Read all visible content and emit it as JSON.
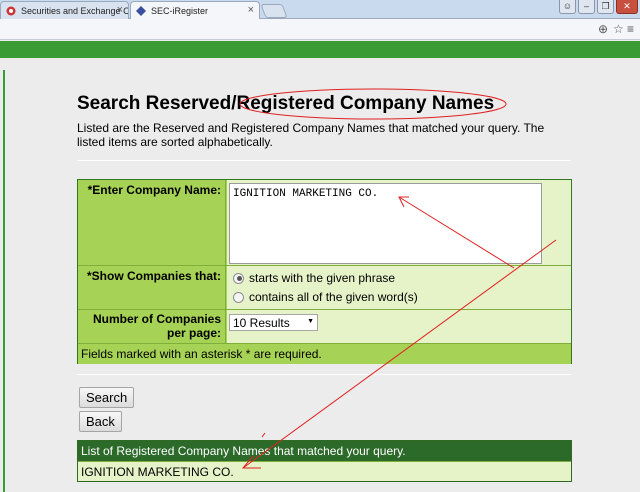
{
  "browser": {
    "tabs": [
      {
        "label": "Securities and Exchange C",
        "active": false
      },
      {
        "label": "SEC-iRegister",
        "active": true
      }
    ]
  },
  "page": {
    "title_part1": "Search Reserved/",
    "title_part2": "Registered Company Names",
    "description": "Listed are the Reserved and Registered Company Names that matched your query. The listed items are sorted alphabetically."
  },
  "form": {
    "company_name_label": "*Enter Company Name:",
    "company_name_value": "IGNITION MARKETING CO.",
    "show_label": "*Show Companies that:",
    "options": [
      {
        "label": "starts with the given phrase",
        "checked": true
      },
      {
        "label": "contains all of the given word(s)",
        "checked": false
      }
    ],
    "per_page_label": "Number of Companies per page:",
    "per_page_value": "10 Results",
    "required_note": "Fields marked with an asterisk * are required."
  },
  "buttons": {
    "search": "Search",
    "back": "Back"
  },
  "results": {
    "header": "List of Registered Company Names that matched your query.",
    "rows": [
      "IGNITION MARKETING CO."
    ]
  },
  "colors": {
    "brand_green": "#3a9b35",
    "form_label_bg": "#a6d255",
    "form_value_bg": "#e6f2c8",
    "results_header_bg": "#2c6a2a",
    "annotation_red": "#e02020"
  }
}
